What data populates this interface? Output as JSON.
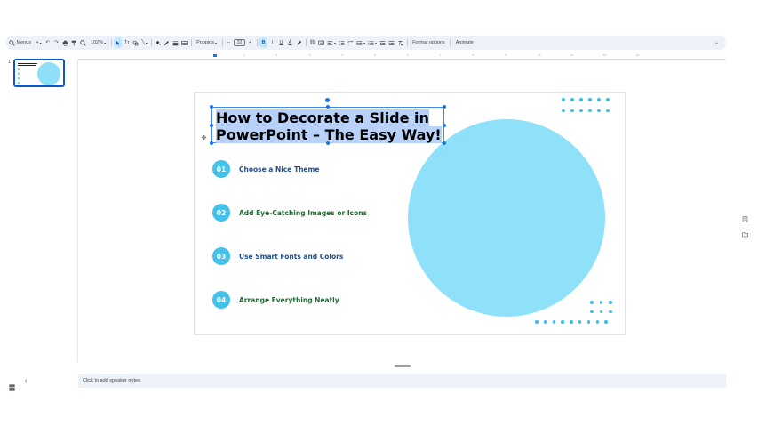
{
  "toolbar": {
    "menus_label": "Menus",
    "zoom": "102%",
    "font": "Poppins",
    "font_size": "32",
    "bold": "B",
    "italic": "I",
    "underline": "U",
    "text_color": "A",
    "format_options": "Format options",
    "animate": "Animate"
  },
  "filmstrip": {
    "slide_number": "1"
  },
  "ruler": {
    "labels": [
      "1",
      "2",
      "3",
      "4",
      "5",
      "6",
      "7",
      "8",
      "9",
      "10",
      "11",
      "12",
      "13"
    ]
  },
  "slide": {
    "title_line1": "How to Decorate a Slide in",
    "title_line2": "PowerPoint – The Easy Way!",
    "items": [
      {
        "num": "01",
        "label": "Choose a Nice Theme",
        "color": "#1f4e8c"
      },
      {
        "num": "02",
        "label": "Add Eye-Catching Images or Icons",
        "color": "#1f6b2e"
      },
      {
        "num": "03",
        "label": "Use Smart Fonts and Colors",
        "color": "#1f4e8c"
      },
      {
        "num": "04",
        "label": "Arrange Everything Neatly",
        "color": "#1f6b2e"
      }
    ],
    "accent_color": "#42c2e8",
    "circle_color": "#8fe1f9"
  },
  "notes": {
    "placeholder": "Click to add speaker notes"
  }
}
